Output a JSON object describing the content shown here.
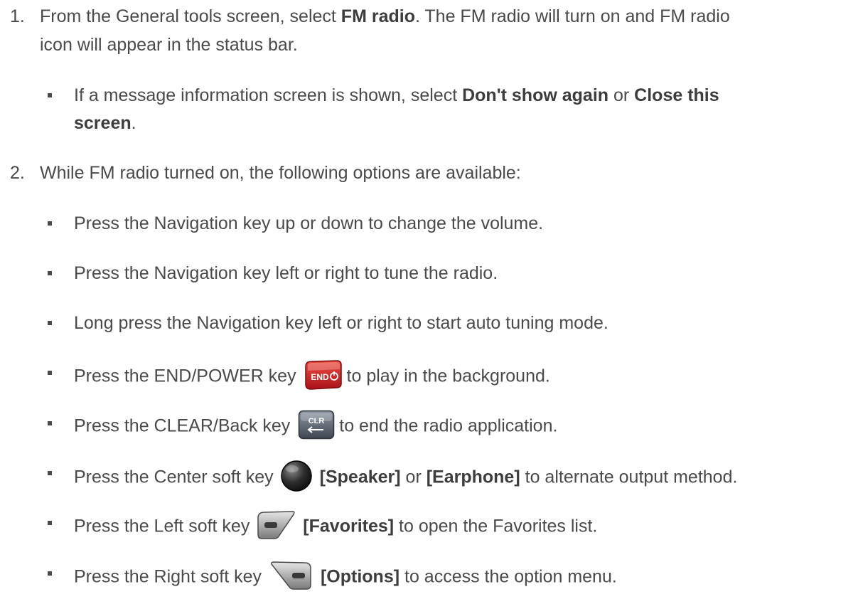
{
  "steps": [
    {
      "number": "1.",
      "line1_a": "From the General tools screen, select ",
      "line1_b": "FM radio",
      "line1_c": ". The FM radio will turn on and FM radio",
      "line2": "icon will appear in the status bar.",
      "bullet": {
        "line1_a": "If a message information screen is shown, select ",
        "line1_b": "Don't show again",
        "line1_c": " or ",
        "line1_d": "Close this",
        "line2_a": "screen",
        "line2_b": "."
      }
    },
    {
      "number": "2.",
      "line1": "While FM radio turned on, the following options are available:",
      "bullets": [
        {
          "text": "Press the Navigation key up or down to change the volume."
        },
        {
          "text": "Press the Navigation key left or right to tune the radio."
        },
        {
          "text": "Long press the Navigation key left or right to start auto tuning mode."
        },
        {
          "pre": "Press the END/POWER key",
          "icon": "end-power-key-icon",
          "icon_label": "END",
          "post": "to play in the background."
        },
        {
          "pre": "Press the CLEAR/Back key",
          "icon": "clear-back-key-icon",
          "icon_label": "CLR",
          "post": "to end the radio application."
        },
        {
          "pre": "Press the Center soft key",
          "icon": "center-soft-key-icon",
          "bold1": "[Speaker]",
          "mid": " or ",
          "bold2": "[Earphone]",
          "post": " to alternate output method."
        },
        {
          "pre": "Press the Left soft key",
          "icon": "left-soft-key-icon",
          "bold1": "[Favorites]",
          "post": " to open the Favorites list."
        },
        {
          "pre": "Press the Right soft key",
          "icon": "right-soft-key-icon",
          "bold1": "[Options]",
          "post": " to access the option menu."
        }
      ]
    }
  ],
  "colors": {
    "text": "#4a4a4a",
    "end_key": "#d9252a",
    "clr_key": "#5a6470"
  }
}
